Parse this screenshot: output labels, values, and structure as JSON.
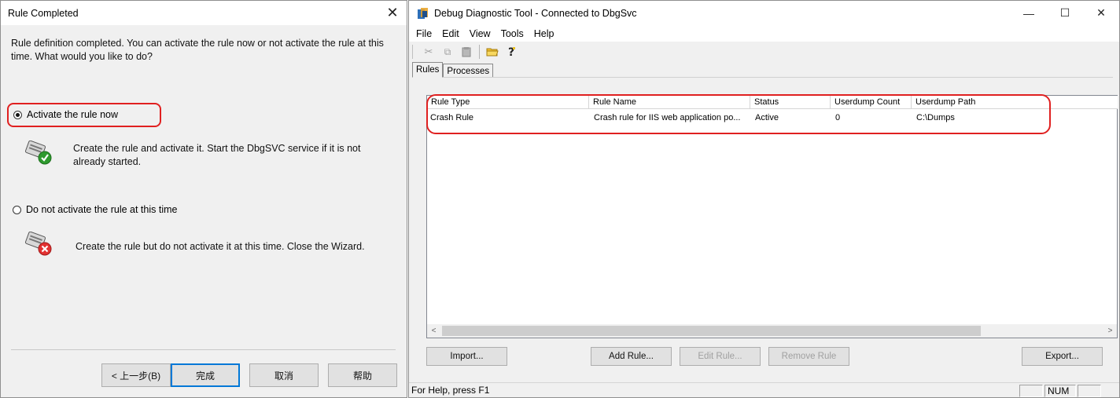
{
  "dialog": {
    "title": "Rule Completed",
    "close_glyph": "✕",
    "intro": "Rule definition completed. You can activate the rule now or not activate the rule at this time. What would you like to do?",
    "options": [
      {
        "label": "Activate the rule now",
        "selected": true,
        "description": "Create the rule and activate it. Start the DbgSVC service if it is not already started.",
        "icon": "activate-rule-icon"
      },
      {
        "label": "Do not activate the rule at this time",
        "selected": false,
        "description": "Create the rule but do not activate it at this time. Close the Wizard.",
        "icon": "do-not-activate-rule-icon"
      }
    ],
    "buttons": {
      "back": "< 上一步(B)",
      "finish": "完成",
      "cancel": "取消",
      "help": "帮助"
    },
    "highlight_color": "#e02020"
  },
  "app": {
    "title": "Debug Diagnostic Tool - Connected to DbgSvc",
    "window_controls": {
      "minimize": "—",
      "maximize": "☐",
      "close": "✕"
    },
    "menu": [
      "File",
      "Edit",
      "View",
      "Tools",
      "Help"
    ],
    "toolbar": [
      {
        "icon": "cut-icon",
        "glyph": "✂",
        "enabled": false
      },
      {
        "icon": "copy-icon",
        "glyph": "⧉",
        "enabled": false
      },
      {
        "icon": "paste-icon",
        "glyph": "📋",
        "enabled": false
      },
      {
        "icon": "open-folder-icon",
        "glyph": "📂",
        "enabled": true
      },
      {
        "icon": "help-icon",
        "glyph": "?",
        "enabled": true
      }
    ],
    "tabs": [
      "Rules",
      "Processes"
    ],
    "active_tab": "Rules",
    "columns": [
      "Rule Type",
      "Rule Name",
      "Status",
      "Userdump Count",
      "Userdump Path"
    ],
    "rows": [
      [
        "Crash Rule",
        "Crash rule for IIS web application po...",
        "Active",
        "0",
        "C:\\Dumps"
      ]
    ],
    "buttons": {
      "import": "Import...",
      "add_rule": "Add Rule...",
      "edit_rule": "Edit Rule...",
      "remove_rule": "Remove Rule",
      "export": "Export..."
    },
    "status": {
      "help_text": "For Help, press F1",
      "num": "NUM"
    },
    "scroll_arrows": {
      "left": "<",
      "right": ">"
    }
  }
}
